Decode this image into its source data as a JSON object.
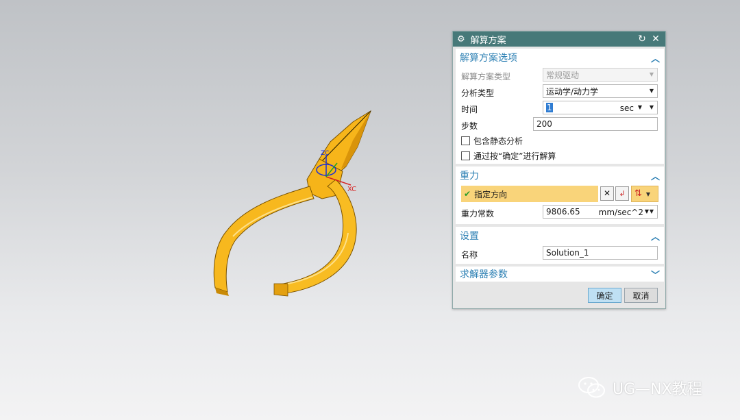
{
  "dialog": {
    "title": "解算方案",
    "sections": {
      "solution_options": {
        "header": "解算方案选项",
        "solution_type_label": "解算方案类型",
        "solution_type_value": "常规驱动",
        "analysis_type_label": "分析类型",
        "analysis_type_value": "运动学/动力学",
        "time_label": "时间",
        "time_value": "1",
        "time_unit": "sec",
        "steps_label": "步数",
        "steps_value": "200",
        "static_analysis_label": "包含静态分析",
        "solve_on_ok_label": "通过按“确定”进行解算"
      },
      "gravity": {
        "header": "重力",
        "specify_direction_label": "指定方向",
        "gravity_constant_label": "重力常数",
        "gravity_constant_value": "9806.65",
        "gravity_unit": "mm/sec^2"
      },
      "settings": {
        "header": "设置",
        "name_label": "名称",
        "name_value": "Solution_1"
      },
      "solver_params": {
        "header": "求解器参数"
      }
    },
    "ok_label": "确定",
    "cancel_label": "取消"
  },
  "viewport": {
    "axis_x_label": "XC",
    "axis_z_label": "ZC",
    "model_color": "#f5b216"
  },
  "watermark": {
    "text": "UG—NX教程"
  },
  "colors": {
    "title_bar": "#477979",
    "section_header": "#2b7fb3",
    "highlight": "#f9d47a"
  }
}
